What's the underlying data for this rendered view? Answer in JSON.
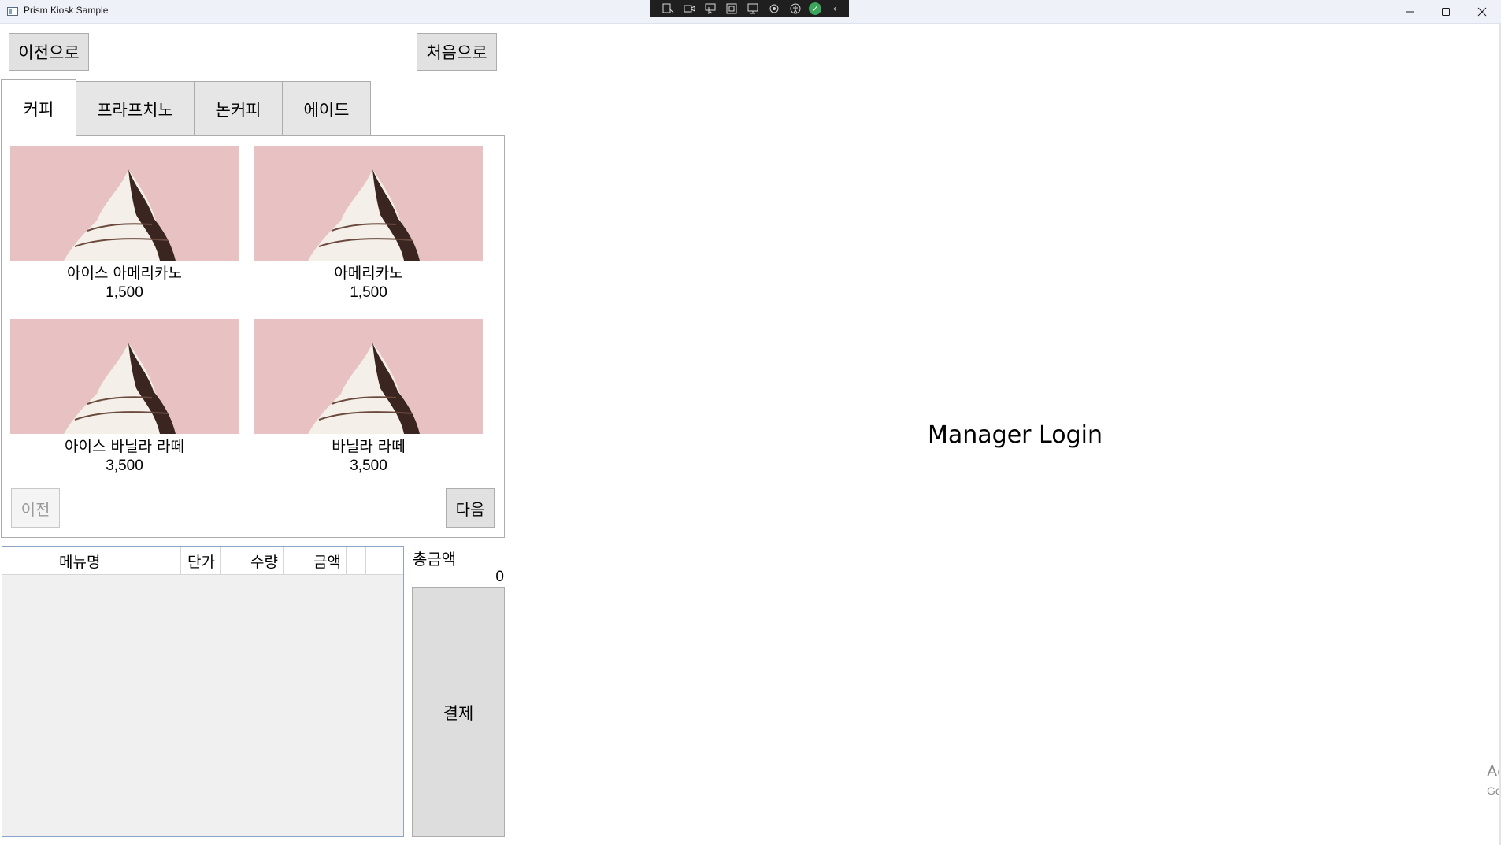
{
  "window": {
    "title": "Prism Kiosk Sample",
    "controls": [
      "minimize-icon",
      "maximize-icon",
      "close-icon"
    ]
  },
  "nav": {
    "back_label": "이전으로",
    "home_label": "처음으로"
  },
  "tabs": [
    {
      "label": "커피",
      "selected": true
    },
    {
      "label": "프라프치노",
      "selected": false
    },
    {
      "label": "논커피",
      "selected": false
    },
    {
      "label": "에이드",
      "selected": false
    }
  ],
  "products": [
    {
      "name": "아이스 아메리카노",
      "price": "1,500"
    },
    {
      "name": "아메리카노",
      "price": "1,500"
    },
    {
      "name": "아이스 바닐라 라떼",
      "price": "3,500"
    },
    {
      "name": "바닐라 라떼",
      "price": "3,500"
    }
  ],
  "pager": {
    "prev_label": "이전",
    "next_label": "다음",
    "prev_enabled": false
  },
  "order_grid": {
    "columns": [
      "메뉴명",
      "단가",
      "수량",
      "금액"
    ],
    "rows": []
  },
  "total": {
    "label": "총금액",
    "value": "0"
  },
  "pay": {
    "label": "결제"
  },
  "manager": {
    "label": "Manager Login"
  },
  "activation": {
    "line1": "Ac",
    "line2": "Go"
  },
  "colors": {
    "titlebar": "#eef2f8",
    "button": "#e1e1e1",
    "image_bg": "#e8c2c2",
    "grid_border": "#8ba3c4"
  }
}
